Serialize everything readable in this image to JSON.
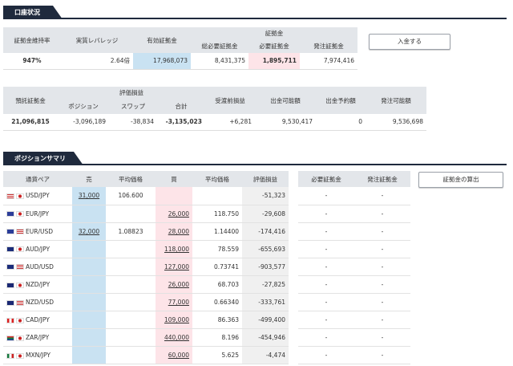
{
  "section1": {
    "title": "口座状況"
  },
  "account": {
    "headers": {
      "maintenance_rate": "証拠金維持率",
      "real_leverage": "実質レバレッジ",
      "effective_margin": "有効証拠金",
      "margin_group": "証拠金",
      "total_required": "総必要証拠金",
      "required": "必要証拠金",
      "order_margin": "発注証拠金"
    },
    "values": {
      "maintenance_rate": "947%",
      "real_leverage": "2.64倍",
      "effective_margin": "17,968,073",
      "total_required": "8,431,375",
      "required": "1,895,711",
      "order_margin": "7,974,416"
    },
    "deposit_button": "入金する"
  },
  "balance": {
    "headers": {
      "deposit": "預託証拠金",
      "valuation_group": "評価損益",
      "position": "ポジション",
      "swap": "スワップ",
      "total": "合計",
      "unsettled": "受渡前損益",
      "withdrawable": "出金可能額",
      "withdraw_reserved": "出金予約額",
      "order_available": "発注可能額"
    },
    "values": {
      "deposit": "21,096,815",
      "position": "-3,096,189",
      "swap": "-38,834",
      "total": "-3,135,023",
      "unsettled": "+6,281",
      "withdrawable": "9,530,417",
      "withdraw_reserved": "0",
      "order_available": "9,536,698"
    }
  },
  "section2": {
    "title": "ポジションサマリ"
  },
  "summary": {
    "headers": {
      "pair": "通貨ペア",
      "sell": "売",
      "avg_sell": "平均価格",
      "buy": "買",
      "avg_buy": "平均価格",
      "pl": "評価損益",
      "req": "必要証拠金",
      "order": "発注証拠金"
    },
    "calc_button": "証拠金の算出",
    "rows": [
      {
        "f1": "us",
        "f2": "jp",
        "pair": "USD/JPY",
        "sell": "31,000",
        "avg_sell": "106.600",
        "buy": "",
        "avg_buy": "",
        "pl": "-51,323",
        "req": "-",
        "order": "-"
      },
      {
        "f1": "eu",
        "f2": "jp",
        "pair": "EUR/JPY",
        "sell": "",
        "avg_sell": "",
        "buy": "26,000",
        "avg_buy": "118.750",
        "pl": "-29,608",
        "req": "-",
        "order": "-"
      },
      {
        "f1": "eu",
        "f2": "us",
        "pair": "EUR/USD",
        "sell": "32,000",
        "avg_sell": "1.08823",
        "buy": "28,000",
        "avg_buy": "1.14400",
        "pl": "-174,416",
        "req": "-",
        "order": "-"
      },
      {
        "f1": "au",
        "f2": "jp",
        "pair": "AUD/JPY",
        "sell": "",
        "avg_sell": "",
        "buy": "118,000",
        "avg_buy": "78.559",
        "pl": "-655,693",
        "req": "-",
        "order": "-"
      },
      {
        "f1": "au",
        "f2": "us",
        "pair": "AUD/USD",
        "sell": "",
        "avg_sell": "",
        "buy": "127,000",
        "avg_buy": "0.73741",
        "pl": "-903,577",
        "req": "-",
        "order": "-"
      },
      {
        "f1": "nz",
        "f2": "jp",
        "pair": "NZD/JPY",
        "sell": "",
        "avg_sell": "",
        "buy": "26,000",
        "avg_buy": "68.703",
        "pl": "-27,825",
        "req": "-",
        "order": "-"
      },
      {
        "f1": "nz",
        "f2": "us",
        "pair": "NZD/USD",
        "sell": "",
        "avg_sell": "",
        "buy": "77,000",
        "avg_buy": "0.66340",
        "pl": "-333,761",
        "req": "-",
        "order": "-"
      },
      {
        "f1": "ca",
        "f2": "jp",
        "pair": "CAD/JPY",
        "sell": "",
        "avg_sell": "",
        "buy": "109,000",
        "avg_buy": "86.363",
        "pl": "-499,400",
        "req": "-",
        "order": "-"
      },
      {
        "f1": "za",
        "f2": "jp",
        "pair": "ZAR/JPY",
        "sell": "",
        "avg_sell": "",
        "buy": "440,000",
        "avg_buy": "8.196",
        "pl": "-454,946",
        "req": "-",
        "order": "-"
      },
      {
        "f1": "mx",
        "f2": "jp",
        "pair": "MXN/JPY",
        "sell": "",
        "avg_sell": "",
        "buy": "60,000",
        "avg_buy": "5.625",
        "pl": "-4,474",
        "req": "-",
        "order": "-"
      }
    ]
  }
}
